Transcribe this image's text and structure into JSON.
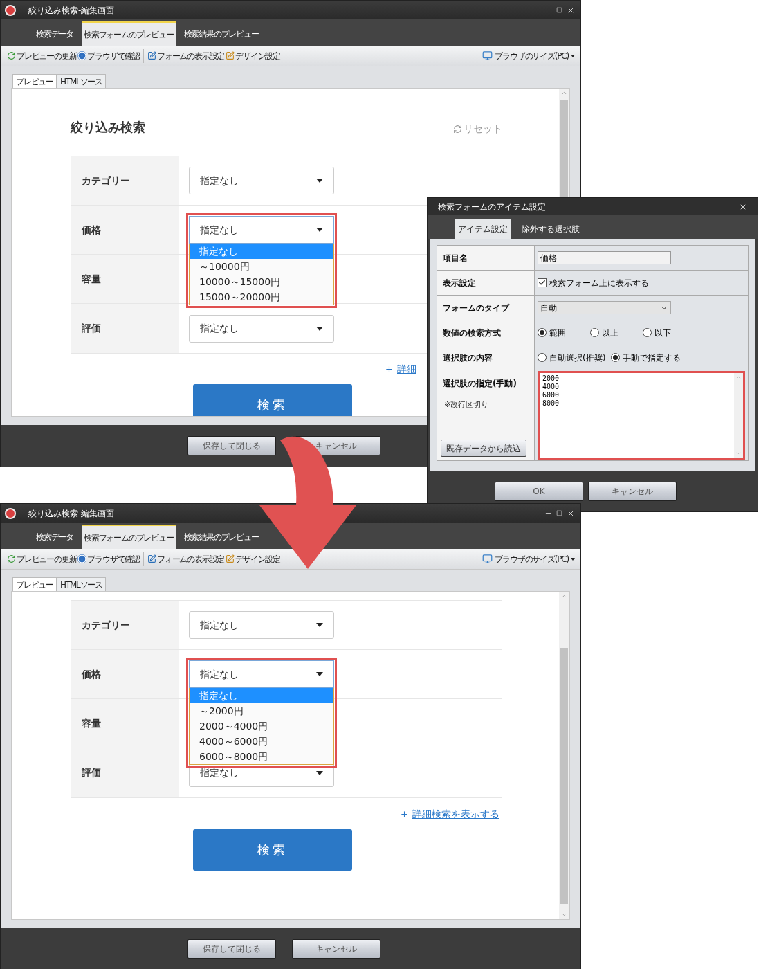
{
  "windows": [
    {
      "title": "絞り込み検索-編集画面",
      "tabs": [
        {
          "label": "検索データ",
          "selected": false
        },
        {
          "label": "検索フォームのプレビュー",
          "selected": true
        },
        {
          "label": "検索結果のプレビュー",
          "selected": false
        }
      ],
      "toolbar": [
        {
          "kind": "refresh",
          "label": "プレビューの更新"
        },
        {
          "kind": "info",
          "label": "ブラウザで確認"
        },
        {
          "kind": "form",
          "label": "フォームの表示設定"
        },
        {
          "kind": "design",
          "label": "デザイン設定"
        }
      ],
      "size_menu": "ブラウザのサイズ(PC)",
      "view_tabs": [
        {
          "label": "プレビュー",
          "selected": true
        },
        {
          "label": "HTMLソース",
          "selected": false
        }
      ],
      "preview": {
        "heading": "絞り込み検索",
        "reset": "リセット",
        "fields": [
          {
            "label": "カテゴリー",
            "value": "指定なし",
            "expanded": false,
            "highlighted": false
          },
          {
            "label": "価格",
            "value": "指定なし",
            "expanded": true,
            "highlighted": true,
            "options": [
              {
                "label": "指定なし",
                "selected": true
              },
              {
                "label": "～10000円",
                "selected": false
              },
              {
                "label": "10000～15000円",
                "selected": false
              },
              {
                "label": "15000～20000円",
                "selected": false
              }
            ]
          },
          {
            "label": "容量",
            "expanded": false,
            "highlighted": false
          },
          {
            "label": "評価",
            "value": "指定なし",
            "expanded": false,
            "highlighted": false
          }
        ],
        "link": "詳細",
        "search_button": "検索"
      },
      "buttons": [
        "保存して閉じる",
        "キャンセル"
      ]
    },
    {
      "title": "絞り込み検索-編集画面",
      "tabs": [
        {
          "label": "検索データ",
          "selected": false
        },
        {
          "label": "検索フォームのプレビュー",
          "selected": true
        },
        {
          "label": "検索結果のプレビュー",
          "selected": false
        }
      ],
      "toolbar": [
        {
          "kind": "refresh",
          "label": "プレビューの更新"
        },
        {
          "kind": "info",
          "label": "ブラウザで確認"
        },
        {
          "kind": "form",
          "label": "フォームの表示設定"
        },
        {
          "kind": "design",
          "label": "デザイン設定"
        }
      ],
      "size_menu": "ブラウザのサイズ(PC)",
      "view_tabs": [
        {
          "label": "プレビュー",
          "selected": true
        },
        {
          "label": "HTMLソース",
          "selected": false
        }
      ],
      "preview": {
        "fields": [
          {
            "label": "カテゴリー",
            "value": "指定なし",
            "expanded": false,
            "highlighted": false
          },
          {
            "label": "価格",
            "value": "指定なし",
            "expanded": true,
            "highlighted": true,
            "options": [
              {
                "label": "指定なし",
                "selected": true
              },
              {
                "label": "～2000円",
                "selected": false
              },
              {
                "label": "2000～4000円",
                "selected": false
              },
              {
                "label": "4000～6000円",
                "selected": false
              },
              {
                "label": "6000～8000円",
                "selected": false
              }
            ]
          },
          {
            "label": "容量",
            "expanded": false,
            "highlighted": false
          },
          {
            "label": "評価",
            "value": "指定なし",
            "expanded": false,
            "highlighted": false
          }
        ],
        "link": "詳細検索を表示する",
        "search_button": "検索"
      },
      "buttons": [
        "保存して閉じる",
        "キャンセル"
      ]
    }
  ],
  "dialog": {
    "title": "検索フォームのアイテム設定",
    "tabs": [
      {
        "label": "アイテム設定",
        "selected": true
      },
      {
        "label": "除外する選択肢",
        "selected": false
      }
    ],
    "rows": [
      {
        "kind": "text",
        "label": "項目名",
        "value": "価格"
      },
      {
        "kind": "checkbox",
        "label": "表示設定",
        "option": "検索フォーム上に表示する",
        "checked": true
      },
      {
        "kind": "select",
        "label": "フォームのタイプ",
        "value": "自動"
      },
      {
        "kind": "radio",
        "label": "数値の検索方式",
        "options": [
          {
            "label": "範囲",
            "selected": true
          },
          {
            "label": "以上",
            "selected": false
          },
          {
            "label": "以下",
            "selected": false
          }
        ]
      },
      {
        "kind": "radio",
        "label": "選択肢の内容",
        "options": [
          {
            "label": "自動選択(推奨)",
            "selected": false
          },
          {
            "label": "手動で指定する",
            "selected": true
          }
        ]
      },
      {
        "kind": "textarea",
        "label": "選択肢の指定(手動)",
        "note": "※改行区切り",
        "button": "既存データから読込",
        "value": "2000\n4000\n6000\n8000",
        "highlighted": true
      }
    ],
    "buttons": [
      "OK",
      "キャンセル"
    ]
  }
}
